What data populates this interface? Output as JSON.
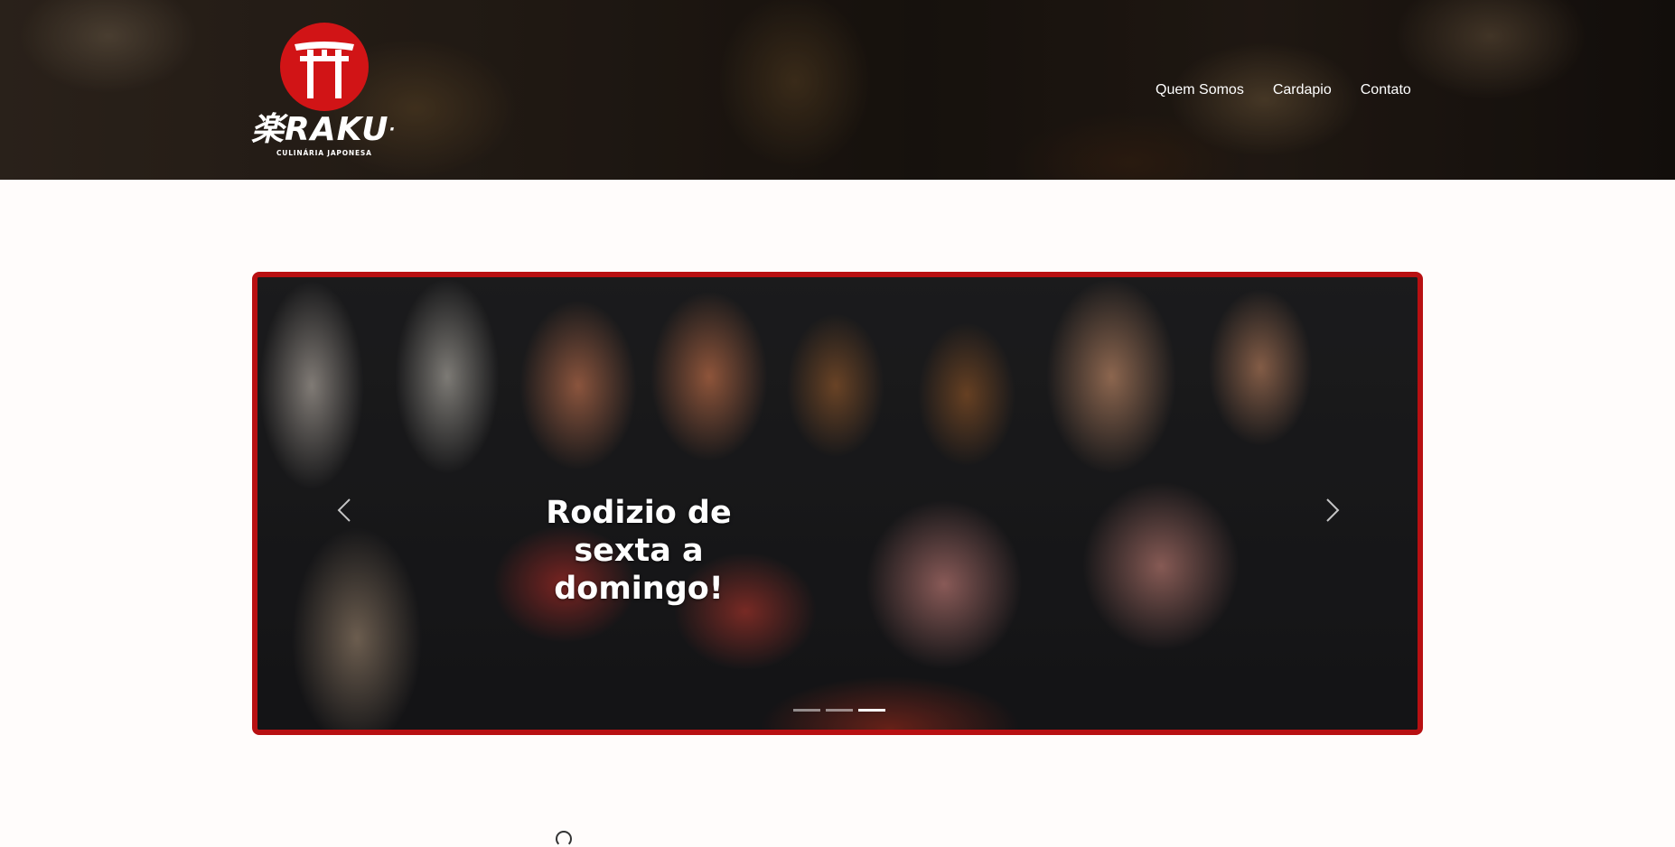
{
  "header": {
    "logo": {
      "kanji": "楽",
      "name": "RAKU",
      "tagline": "CULINÁRIA JAPONESA",
      "brand_color": "#d11416"
    },
    "nav": [
      {
        "label": "Quem Somos"
      },
      {
        "label": "Cardapio"
      },
      {
        "label": "Contato"
      }
    ]
  },
  "carousel": {
    "border_color": "#b81012",
    "caption": "Rodizio de sexta a domingo!",
    "prev_icon": "chevron-left-icon",
    "next_icon": "chevron-right-icon",
    "indicators": [
      {
        "active": false
      },
      {
        "active": false
      },
      {
        "active": true
      }
    ]
  }
}
